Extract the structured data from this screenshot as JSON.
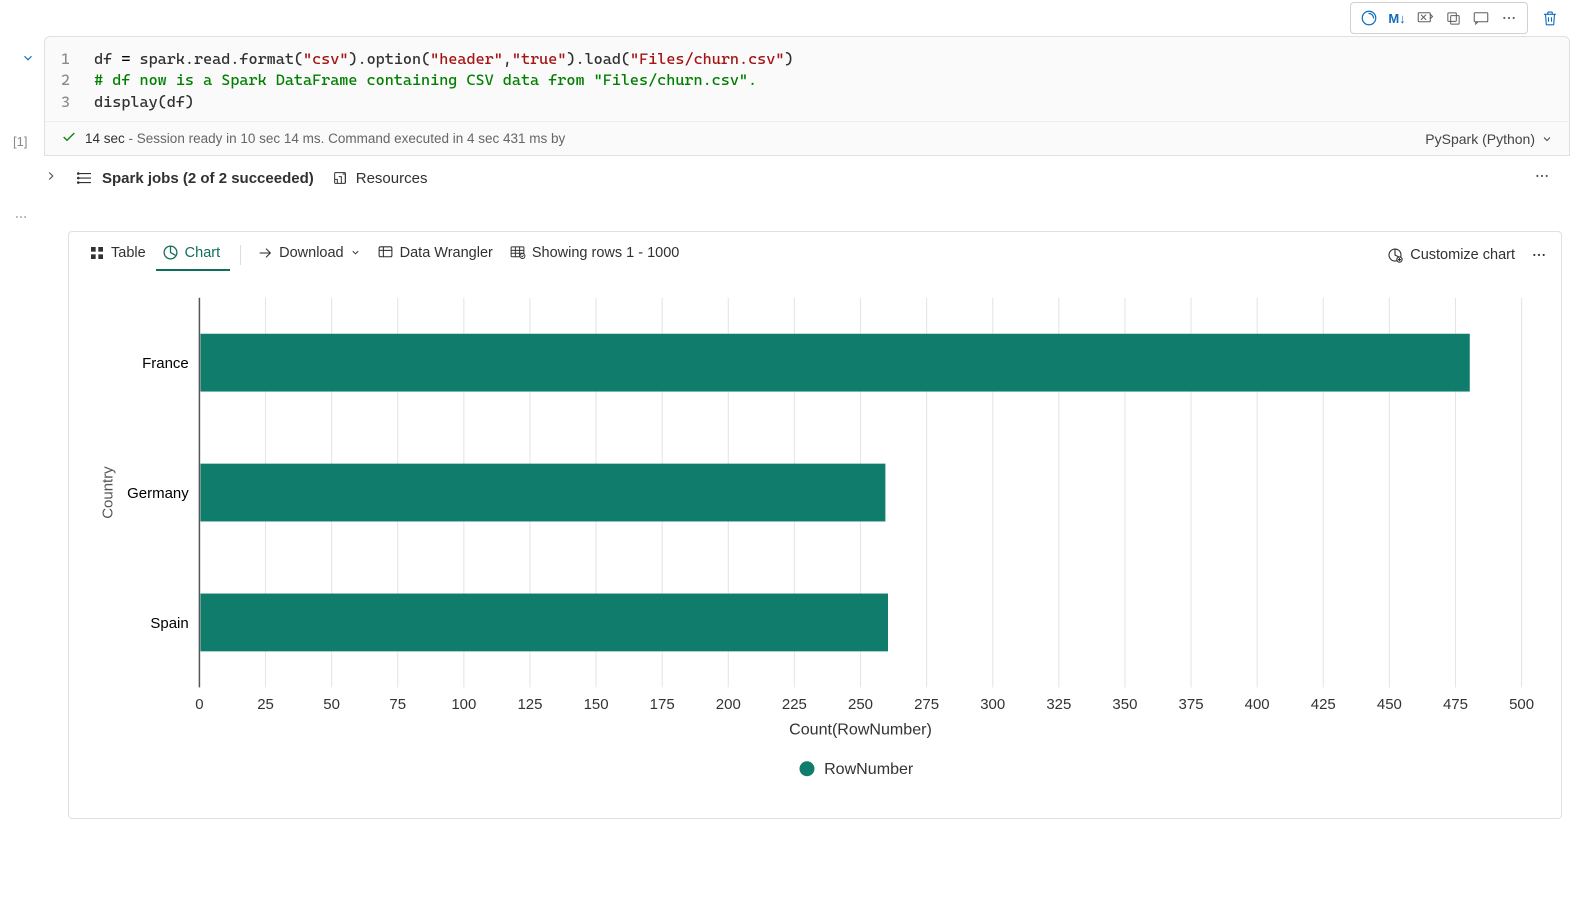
{
  "cellIndex": "[1]",
  "toolbar": {
    "markdown_label": "M↓"
  },
  "code_lines": [
    {
      "n": "1",
      "html": "df <span class='tok-id'>=</span> spark.read.format(<span class='tok-str'>\"csv\"</span>).option(<span class='tok-str'>\"header\"</span>,<span class='tok-str'>\"true\"</span>).load(<span class='tok-str'>\"Files/churn.csv\"</span>)"
    },
    {
      "n": "2",
      "html": "<span class='tok-cmt'># df now is a Spark DataFrame containing CSV data from \"Files/churn.csv\".</span>"
    },
    {
      "n": "3",
      "html": "display(df)"
    }
  ],
  "status": {
    "time": "14 sec",
    "text": "- Session ready in 10 sec 14 ms. Command executed in 4 sec 431 ms by",
    "language": "PySpark (Python)"
  },
  "jobs": {
    "label": "Spark jobs (2 of 2 succeeded)",
    "resources": "Resources"
  },
  "output_tabs": {
    "table": "Table",
    "chart": "Chart",
    "download": "Download",
    "wrangler": "Data Wrangler",
    "rows": "Showing rows 1 - 1000",
    "customize": "Customize chart"
  },
  "chart_data": {
    "type": "bar",
    "orientation": "horizontal",
    "ylabel": "Country",
    "xlabel": "Count(RowNumber)",
    "legend": "RowNumber",
    "xlim": [
      0,
      500
    ],
    "xticks": [
      0,
      25,
      50,
      75,
      100,
      125,
      150,
      175,
      200,
      225,
      250,
      275,
      300,
      325,
      350,
      375,
      400,
      425,
      450,
      475,
      500
    ],
    "categories": [
      "France",
      "Germany",
      "Spain"
    ],
    "values": [
      480,
      259,
      260
    ]
  }
}
